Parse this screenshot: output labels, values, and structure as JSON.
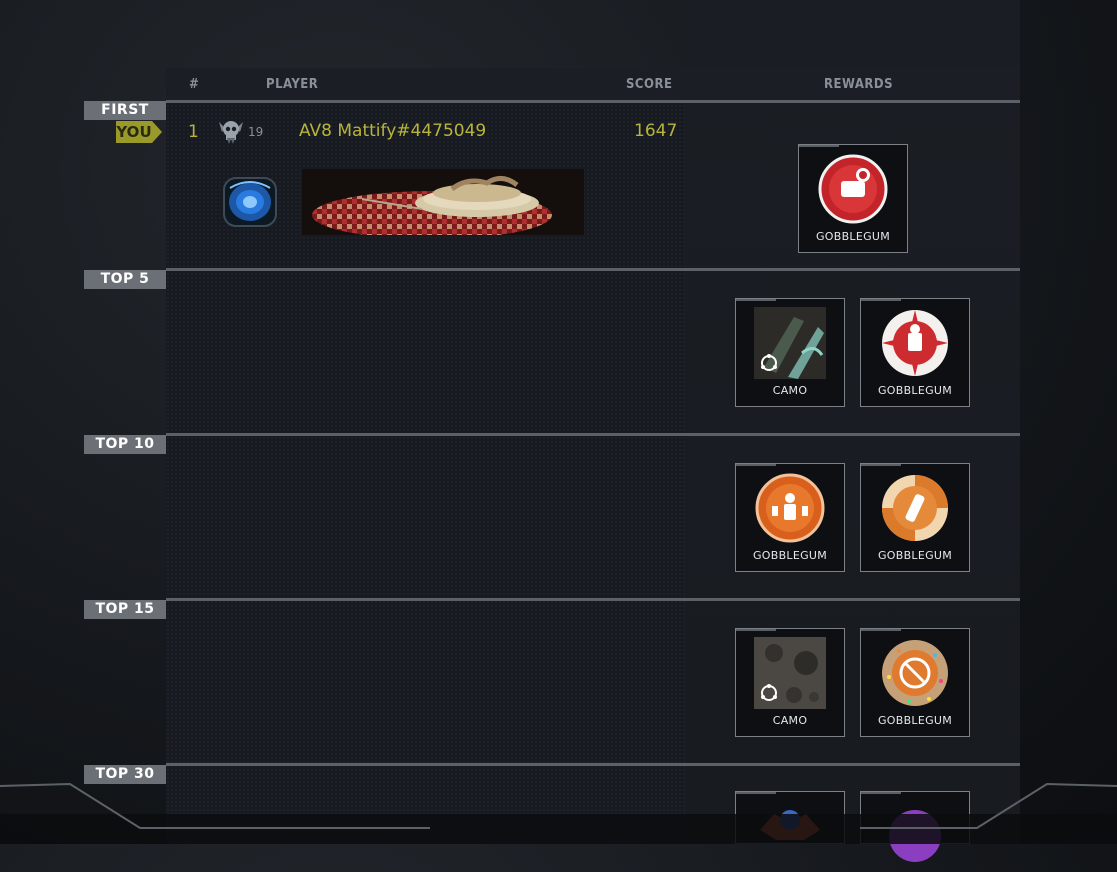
{
  "header": {
    "rank_col": "#",
    "player_col": "PLAYER",
    "score_col": "SCORE",
    "rewards_col": "REWARDS"
  },
  "player": {
    "you_tag": "YOU",
    "rank": "1",
    "level": "19",
    "name": "AV8 Mattify#4475049",
    "score": "1647"
  },
  "tiers": [
    {
      "label": "FIRST",
      "rewards": [
        {
          "label": "GOBBLEGUM",
          "icon": "gobblegum-red-icon"
        }
      ]
    },
    {
      "label": "TOP 5",
      "rewards": [
        {
          "label": "CAMO",
          "icon": "camo-icon"
        },
        {
          "label": "GOBBLEGUM",
          "icon": "gobblegum-candy-icon"
        }
      ]
    },
    {
      "label": "TOP 10",
      "rewards": [
        {
          "label": "GOBBLEGUM",
          "icon": "gobblegum-orange-icon"
        },
        {
          "label": "GOBBLEGUM",
          "icon": "gobblegum-orange-swirl-icon"
        }
      ]
    },
    {
      "label": "TOP 15",
      "rewards": [
        {
          "label": "CAMO",
          "icon": "camo-moon-icon"
        },
        {
          "label": "GOBBLEGUM",
          "icon": "gobblegum-sprinkles-icon"
        }
      ]
    },
    {
      "label": "TOP 30",
      "rewards": [
        {
          "label": "",
          "icon": "fire-emblem-icon"
        },
        {
          "label": "",
          "icon": "gobblegum-purple-icon"
        }
      ]
    }
  ],
  "colors": {
    "accent": "#b8b43c",
    "tier_label_bg": "#6b7076",
    "row_line": "#5c6168"
  }
}
